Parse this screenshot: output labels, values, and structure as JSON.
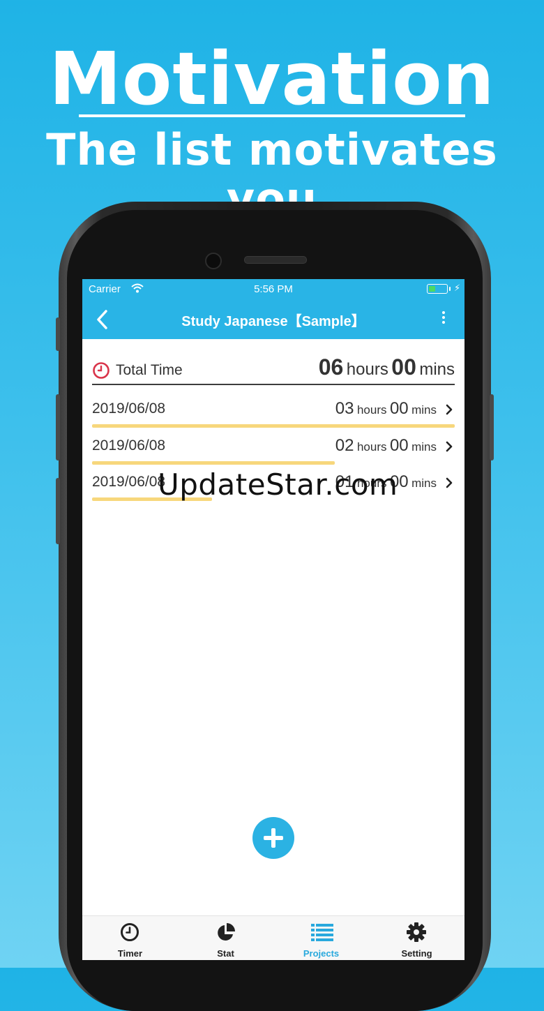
{
  "promo": {
    "headline": "Motivation",
    "subhead": "The list motivates you"
  },
  "status_bar": {
    "carrier": "Carrier",
    "time": "5:56 PM"
  },
  "nav": {
    "title": "Study Japanese【Sample】"
  },
  "summary": {
    "label": "Total Time",
    "hours": "06",
    "hours_unit": "hours",
    "mins": "00",
    "mins_unit": "mins"
  },
  "entries": [
    {
      "date": "2019/06/08",
      "hours": "03",
      "hours_unit": "hours",
      "mins": "00",
      "mins_unit": "mins",
      "progress": 1.0
    },
    {
      "date": "2019/06/08",
      "hours": "02",
      "hours_unit": "hours",
      "mins": "00",
      "mins_unit": "mins",
      "progress": 0.67
    },
    {
      "date": "2019/06/08",
      "hours": "01",
      "hours_unit": "hours",
      "mins": "00",
      "mins_unit": "mins",
      "progress": 0.33
    }
  ],
  "watermark": "UpdateStar.com",
  "tabs": [
    {
      "label": "Timer",
      "icon": "clock-icon"
    },
    {
      "label": "Stat",
      "icon": "pie-chart-icon"
    },
    {
      "label": "Projects",
      "icon": "list-icon",
      "active": true
    },
    {
      "label": "Setting",
      "icon": "gear-icon"
    }
  ],
  "colors": {
    "background": "#1fb3e6",
    "nav": "#29b4e6",
    "accent": "#29a9dd",
    "progress_bar": "#f7d77c",
    "clock_red": "#d9344a"
  }
}
